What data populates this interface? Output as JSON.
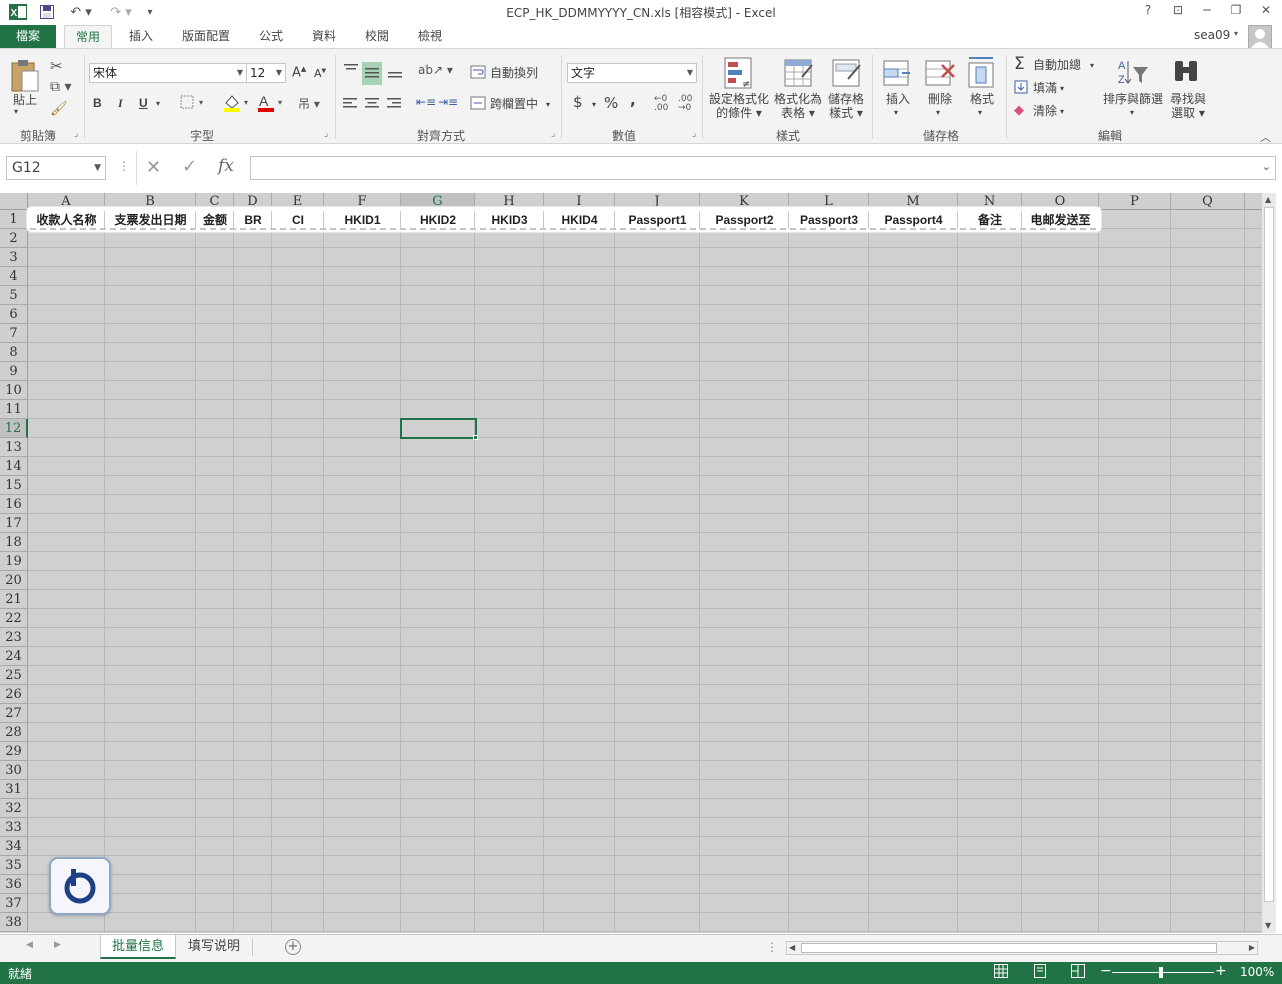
{
  "title": "ECP_HK_DDMMYYYY_CN.xls  [相容模式] - Excel",
  "user": "sea09",
  "window_buttons": {
    "help": "?",
    "ribbon": "⊡",
    "min": "─",
    "restore": "❐",
    "close": "✕"
  },
  "tabs": {
    "file": "檔案",
    "items": [
      {
        "label": "常用",
        "active": true
      },
      {
        "label": "插入"
      },
      {
        "label": "版面配置"
      },
      {
        "label": "公式"
      },
      {
        "label": "資料"
      },
      {
        "label": "校閱"
      },
      {
        "label": "檢視"
      }
    ]
  },
  "ribbon": {
    "clipboard": {
      "label": "剪貼簿",
      "paste": "貼上"
    },
    "font": {
      "label": "字型",
      "font_name": "宋体",
      "font_size": "12",
      "bold": "B",
      "italic": "I",
      "underline": "U"
    },
    "alignment": {
      "label": "對齊方式",
      "wrap": "自動換列",
      "merge": "跨欄置中"
    },
    "number": {
      "label": "數值",
      "format": "文字",
      "currency": "$",
      "percent": "%",
      "comma": ","
    },
    "styles": {
      "label": "樣式",
      "cond1": "設定格式化",
      "cond2": "的條件",
      "table1": "格式化為",
      "table2": "表格",
      "cell1": "儲存格",
      "cell2": "樣式"
    },
    "cells": {
      "label": "儲存格",
      "insert": "插入",
      "delete": "刪除",
      "format": "格式"
    },
    "editing": {
      "label": "編輯",
      "autosum": "自動加總",
      "fill": "填滿",
      "clear": "清除",
      "sort1": "排序與篩選",
      "find1": "尋找與",
      "find2": "選取"
    }
  },
  "formula_bar": {
    "name_box": "G12",
    "value": ""
  },
  "sheet": {
    "selected_cell": "G12",
    "columns": [
      "A",
      "B",
      "C",
      "D",
      "E",
      "F",
      "G",
      "H",
      "I",
      "J",
      "K",
      "L",
      "M",
      "N",
      "O",
      "P",
      "Q"
    ],
    "rows": [
      "1",
      "2",
      "3",
      "4",
      "5",
      "6",
      "7",
      "8",
      "9",
      "10",
      "11",
      "12",
      "13",
      "14",
      "15",
      "16",
      "17",
      "18",
      "19",
      "20",
      "21",
      "22",
      "23",
      "24",
      "25",
      "26",
      "27",
      "28",
      "29",
      "30",
      "31",
      "32",
      "33",
      "34",
      "35",
      "36",
      "37",
      "38"
    ],
    "headers": [
      "收款人名称",
      "支票发出日期",
      "金额",
      "BR",
      "CI",
      "HKID1",
      "HKID2",
      "HKID3",
      "HKID4",
      "Passport1",
      "Passport2",
      "Passport3",
      "Passport4",
      "备注",
      "电邮发送至"
    ]
  },
  "sheet_tabs": [
    {
      "label": "批量信息",
      "active": true
    },
    {
      "label": "填写说明"
    }
  ],
  "status": {
    "ready": "就緒",
    "zoom": "100%"
  }
}
